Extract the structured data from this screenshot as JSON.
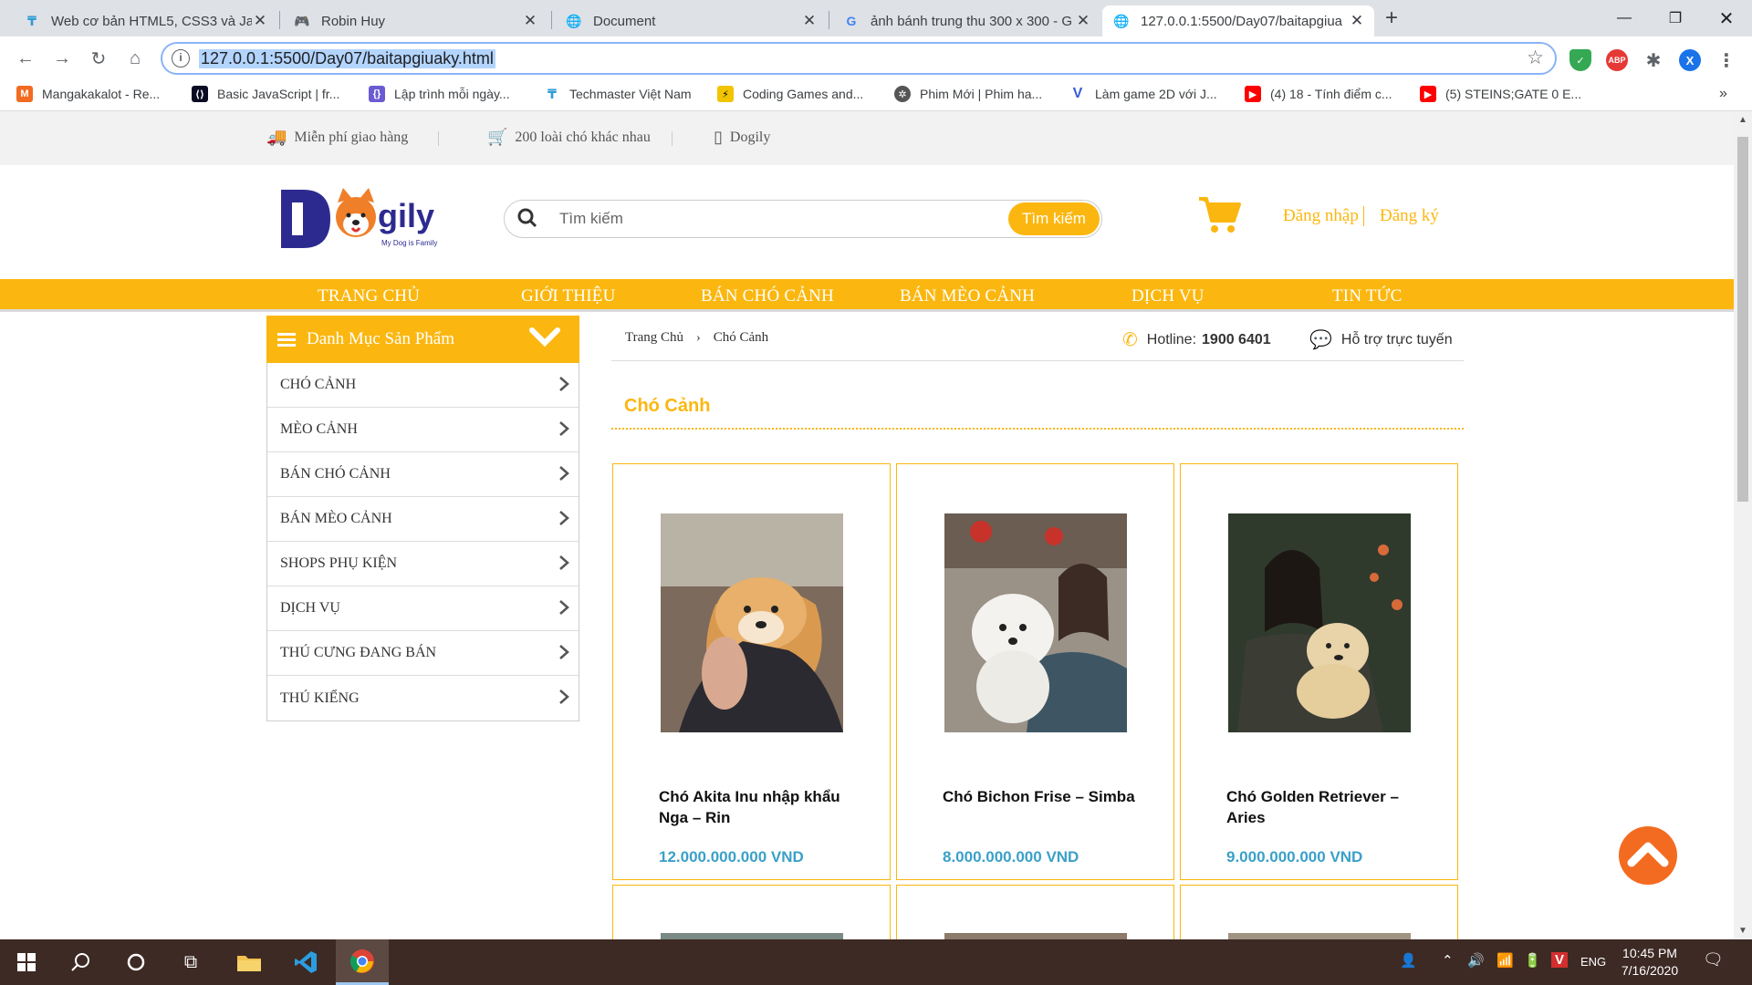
{
  "browser": {
    "tabs": [
      {
        "title": "Web cơ bản HTML5, CSS3 và Jav",
        "icon": "techmaster-icon"
      },
      {
        "title": "Robin Huy",
        "icon": "gamepad-icon"
      },
      {
        "title": "Document",
        "icon": "globe-icon"
      },
      {
        "title": "ảnh bánh trung thu 300 x 300 - G",
        "icon": "google-icon"
      },
      {
        "title": "127.0.0.1:5500/Day07/baitapgiua",
        "icon": "globe-icon",
        "active": true
      }
    ],
    "url": "127.0.0.1:5500/Day07/baitapgiuaky.html",
    "profile_initial": "X",
    "bookmarks": [
      "Mangakakalot - Re...",
      "Basic JavaScript | fr...",
      "Lập trình mỗi ngày...",
      "Techmaster Việt Nam",
      "Coding Games and...",
      "Phim Mới | Phim ha...",
      "Làm game 2D với J...",
      "(4) 18 - Tính điểm c...",
      "(5) STEINS;GATE 0 E..."
    ]
  },
  "site": {
    "topstrip": [
      "Miễn phí giao hàng",
      "200 loài chó khác nhau",
      "Dogily"
    ],
    "logo": {
      "main": "gily",
      "initial": "D",
      "tagline": "My Dog is Family"
    },
    "search": {
      "placeholder": "Tìm kiếm",
      "button": "Tìm kiếm"
    },
    "auth": {
      "login": "Đăng nhập",
      "register": "Đăng ký"
    },
    "nav": [
      "TRANG CHỦ",
      "GIỚI THIỆU",
      "BÁN CHÓ CẢNH",
      "BÁN MÈO CẢNH",
      "DỊCH VỤ",
      "TIN TỨC"
    ],
    "sidebar": {
      "title": "Danh Mục Sản Phẩm",
      "items": [
        "CHÓ CẢNH",
        "MÈO CẢNH",
        "BÁN CHÓ CẢNH",
        "BÁN MÈO CẢNH",
        "SHOPS PHỤ KIỆN",
        "DỊCH VỤ",
        "THÚ CƯNG ĐANG BÁN",
        "THÚ KIỂNG"
      ]
    },
    "breadcrumb": {
      "home": "Trang Chủ",
      "current": "Chó Cảnh"
    },
    "hotline": {
      "label": "Hotline:",
      "number": "1900 6401"
    },
    "support": "Hỗ trợ trực tuyến",
    "section_title": "Chó Cảnh",
    "products": [
      {
        "name": "Chó Akita Inu nhập khẩu Nga – Rin",
        "price": "12.000.000.000 VND"
      },
      {
        "name": "Chó Bichon Frise – Simba",
        "price": "8.000.000.000 VND"
      },
      {
        "name": "Chó Golden Retriever – Aries",
        "price": "9.000.000.000 VND"
      }
    ],
    "colors": {
      "accent": "#fbb710",
      "price": "#3aa0c8",
      "totop": "#f36b21"
    }
  },
  "taskbar": {
    "lang": "ENG",
    "time": "10:45 PM",
    "date": "7/16/2020"
  }
}
